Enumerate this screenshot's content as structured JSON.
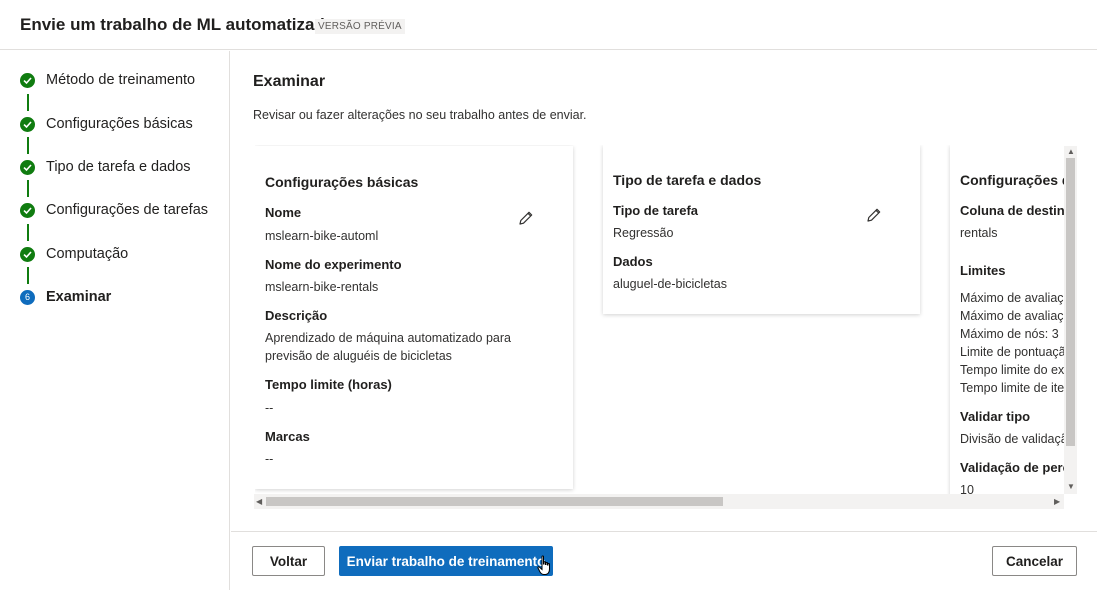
{
  "header": {
    "title": "Envie um trabalho de ML automatizado",
    "badge": "VERSÃO PRÉVIA"
  },
  "steps": [
    {
      "label": "Método de treinamento",
      "state": "done"
    },
    {
      "label": "Configurações básicas",
      "state": "done"
    },
    {
      "label": "Tipo de tarefa e dados",
      "state": "done"
    },
    {
      "label": "Configurações de tarefas",
      "state": "done"
    },
    {
      "label": "Computação",
      "state": "done"
    },
    {
      "label": "Examinar",
      "state": "current",
      "number": "6"
    }
  ],
  "review": {
    "title": "Examinar",
    "description": "Revisar ou fazer alterações no seu trabalho antes de enviar."
  },
  "card_basic": {
    "title": "Configurações básicas",
    "name_label": "Nome",
    "name_value": "mslearn-bike-automl",
    "experiment_label": "Nome do experimento",
    "experiment_value": "mslearn-bike-rentals",
    "description_label": "Descrição",
    "description_line1": "Aprendizado de máquina automatizado para",
    "description_line2": "previsão de aluguéis de bicicletas",
    "timeout_label": "Tempo limite (horas)",
    "timeout_value": "--",
    "tags_label": "Marcas",
    "tags_value": "--"
  },
  "card_task": {
    "title": "Tipo de tarefa e dados",
    "task_label": "Tipo de tarefa",
    "task_value": "Regressão",
    "data_label": "Dados",
    "data_value": "aluguel-de-bicicletas"
  },
  "card_settings": {
    "title": "Configurações d",
    "target_label": "Coluna de destino",
    "target_value": "rentals",
    "limits_label": "Limites",
    "limit_1": "Máximo de avaliaç",
    "limit_2": "Máximo de avaliaç",
    "limit_3": "Máximo de nós: 3",
    "limit_4": "Limite de pontuaçã",
    "limit_5": "Tempo limite do ex",
    "limit_6": "Tempo limite de ite",
    "validation_label": "Validar tipo",
    "validation_value": "Divisão de validaçã",
    "percent_label": "Validação de perce",
    "percent_value": "10"
  },
  "footer": {
    "back_label": "Voltar",
    "submit_label": "Enviar trabalho de treinamento",
    "cancel_label": "Cancelar"
  },
  "colors": {
    "primary": "#0f6cbd",
    "success": "#107c10"
  }
}
